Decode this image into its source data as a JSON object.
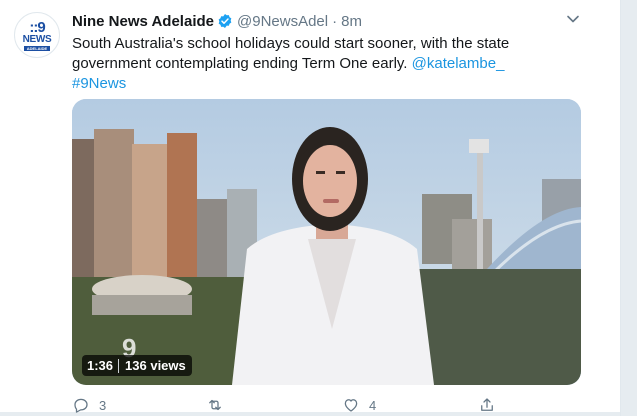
{
  "tweet": {
    "author_name": "Nine News Adelaide",
    "handle": "@9NewsAdel",
    "separator": "·",
    "time": "8m",
    "avatar": {
      "dots": "::9",
      "word": "NEWS",
      "sub": "ADELAIDE",
      "color": "#1c4fa3"
    },
    "text_main": "South Australia's school holidays could start sooner, with the state government contemplating ending Term One early. ",
    "mention": "@katelambe_",
    "hashtag": "#9News",
    "video": {
      "duration": "1:36",
      "views": "136 views",
      "watermark": "9"
    },
    "actions": {
      "reply_count": "3",
      "retweet_count": "",
      "like_count": "4"
    }
  },
  "colors": {
    "link": "#1b95e0",
    "verified": "#1da1f2",
    "muted": "#657786"
  }
}
